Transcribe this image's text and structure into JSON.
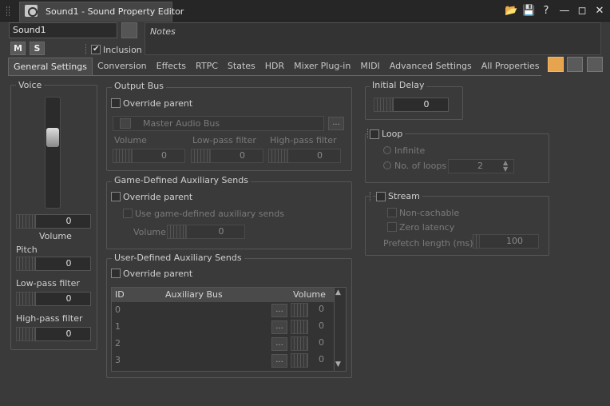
{
  "window": {
    "title": "Sound1 - Sound Property Editor"
  },
  "object": {
    "name": "Sound1",
    "m_label": "M",
    "s_label": "S",
    "inclusion_label": "Inclusion",
    "notes_placeholder": "Notes"
  },
  "tabs": [
    "General Settings",
    "Conversion",
    "Effects",
    "RTPC",
    "States",
    "HDR",
    "Mixer Plug-in",
    "MIDI",
    "Advanced Settings",
    "All Properties",
    "+"
  ],
  "voice": {
    "title": "Voice",
    "volume_value": "0",
    "volume_label": "Volume",
    "pitch_label": "Pitch",
    "pitch_value": "0",
    "lpf_label": "Low-pass filter",
    "lpf_value": "0",
    "hpf_label": "High-pass filter",
    "hpf_value": "0"
  },
  "output_bus": {
    "title": "Output Bus",
    "override_label": "Override parent",
    "bus_name": "Master Audio Bus",
    "browse_label": "...",
    "volume_label": "Volume",
    "volume_value": "0",
    "lpf_label": "Low-pass filter",
    "lpf_value": "0",
    "hpf_label": "High-pass filter",
    "hpf_value": "0"
  },
  "game_sends": {
    "title": "Game-Defined Auxiliary Sends",
    "override_label": "Override parent",
    "use_label": "Use game-defined auxiliary sends",
    "volume_label": "Volume",
    "volume_value": "0"
  },
  "user_sends": {
    "title": "User-Defined Auxiliary Sends",
    "override_label": "Override parent",
    "columns": [
      "ID",
      "Auxiliary Bus",
      "Volume"
    ],
    "rows": [
      {
        "id": "0",
        "bus": "",
        "vol": "0"
      },
      {
        "id": "1",
        "bus": "",
        "vol": "0"
      },
      {
        "id": "2",
        "bus": "",
        "vol": "0"
      },
      {
        "id": "3",
        "bus": "",
        "vol": "0"
      }
    ],
    "browse_label": "..."
  },
  "initial_delay": {
    "title": "Initial Delay",
    "value": "0"
  },
  "loop": {
    "title": "Loop",
    "infinite_label": "Infinite",
    "no_loops_label": "No. of loops",
    "no_loops_value": "2"
  },
  "stream": {
    "title": "Stream",
    "noncachable_label": "Non-cachable",
    "zero_latency_label": "Zero latency",
    "prefetch_label": "Prefetch length (ms)",
    "prefetch_value": "100"
  },
  "colors": {
    "accent": "#e6a44f",
    "background": "#3a3a3a"
  }
}
